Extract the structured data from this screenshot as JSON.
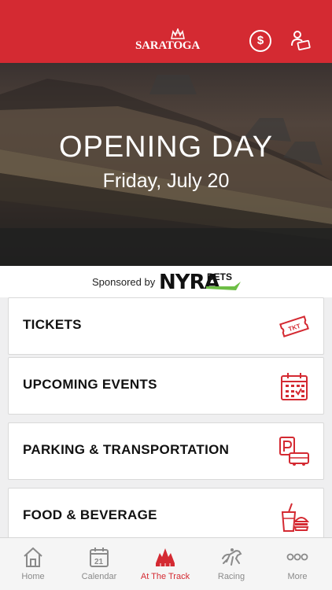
{
  "header": {
    "logo_text": "SARATOGA",
    "dollar_symbol": "$"
  },
  "hero": {
    "title": "OPENING DAY",
    "subtitle": "Friday, July 20"
  },
  "sponsor": {
    "label": "Sponsored by",
    "brand_main": "NYRA",
    "brand_sub": "BETS"
  },
  "menu": [
    {
      "label": "TICKETS",
      "icon": "ticket-icon"
    },
    {
      "label": "UPCOMING EVENTS",
      "icon": "calendar-icon"
    },
    {
      "label": "PARKING & TRANSPORTATION",
      "icon": "parking-bus-icon"
    },
    {
      "label": "FOOD & BEVERAGE",
      "icon": "food-icon"
    }
  ],
  "tabs": [
    {
      "label": "Home",
      "icon": "home-icon",
      "active": false
    },
    {
      "label": "Calendar",
      "icon": "calendar-icon",
      "active": false,
      "day": "21"
    },
    {
      "label": "At The Track",
      "icon": "track-icon",
      "active": true
    },
    {
      "label": "Racing",
      "icon": "horse-icon",
      "active": false
    },
    {
      "label": "More",
      "icon": "more-icon",
      "active": false
    }
  ],
  "colors": {
    "brand_red": "#d42a32",
    "tab_inactive": "#8a8a8a",
    "nyra_green": "#6dbe45"
  }
}
